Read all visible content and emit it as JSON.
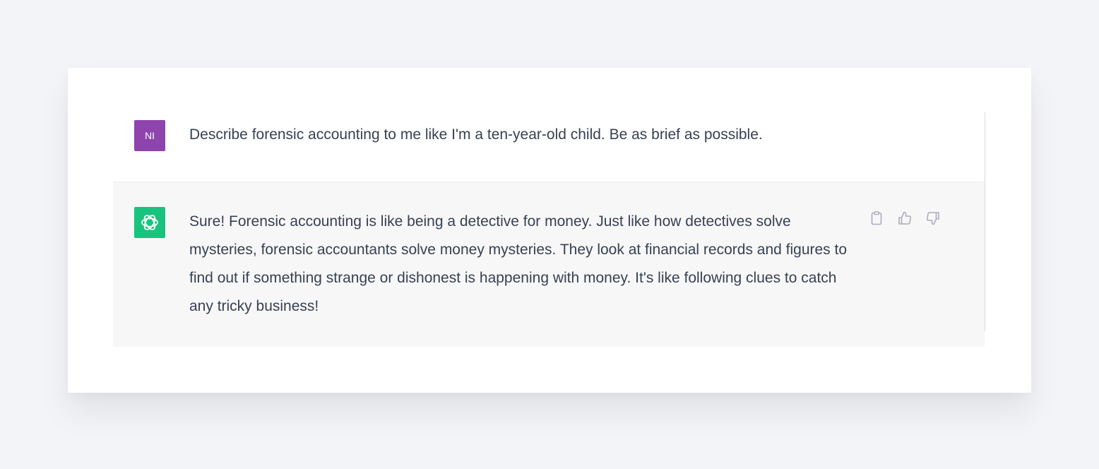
{
  "conversation": {
    "user_message": {
      "avatar_initials": "NI",
      "text": "Describe forensic accounting to me like I'm a ten-year-old child. Be as brief as possible."
    },
    "assistant_message": {
      "avatar_icon": "openai-logo-icon",
      "text": "Sure! Forensic accounting is like being a detective for money. Just like how detectives solve mysteries, forensic accountants solve money mysteries. They look at financial records and figures to find out if something strange or dishonest is happening with money. It's like following clues to catch any tricky business!",
      "actions": [
        "copy-icon",
        "thumbs-up-icon",
        "thumbs-down-icon"
      ]
    }
  },
  "colors": {
    "user_avatar": "#8e44ad",
    "assistant_avatar": "#19c37d",
    "assistant_bg": "#f7f7f8",
    "text": "#374151"
  }
}
